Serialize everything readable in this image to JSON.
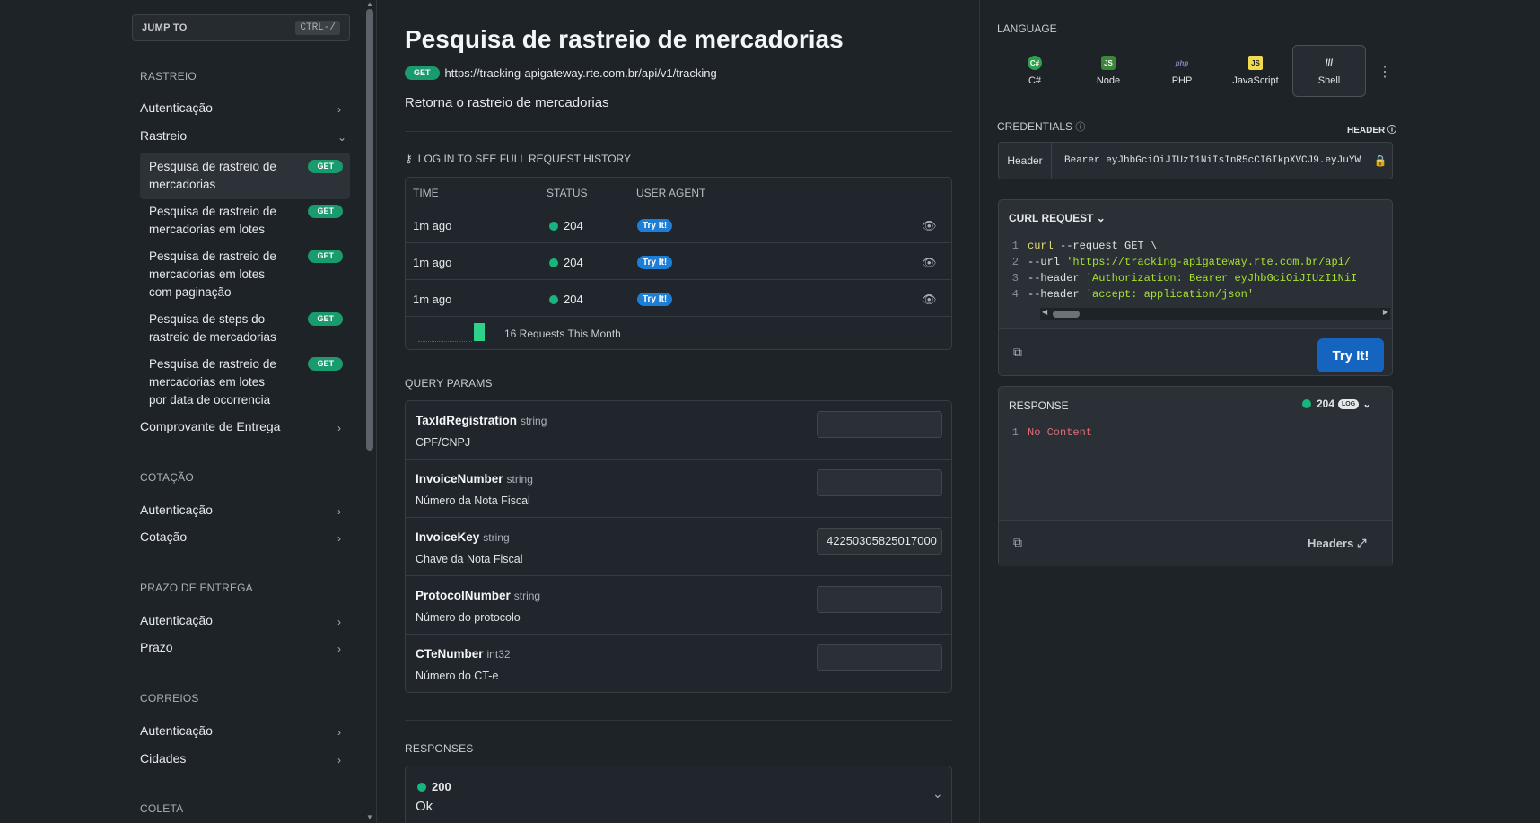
{
  "sidebar": {
    "jump_to": "JUMP TO",
    "shortcut": "CTRL-/",
    "sections": [
      {
        "title": "RASTREIO"
      },
      {
        "title": "COTAÇÃO"
      },
      {
        "title": "PRAZO DE ENTREGA"
      },
      {
        "title": "CORREIOS"
      },
      {
        "title": "COLETA"
      }
    ],
    "rastreio_items": {
      "autenticacao": "Autenticação",
      "rastreio": "Rastreio",
      "comprovante": "Comprovante de Entrega"
    },
    "rastreio_sub": [
      {
        "label": "Pesquisa de rastreio de mercadorias",
        "badge": "GET"
      },
      {
        "label": "Pesquisa de rastreio de mercadorias em lotes",
        "badge": "GET"
      },
      {
        "label": "Pesquisa de rastreio de mercadorias em lotes com paginação",
        "badge": "GET"
      },
      {
        "label": "Pesquisa de steps do rastreio de mercadorias",
        "badge": "GET"
      },
      {
        "label": "Pesquisa de rastreio de mercadorias em lotes por data de ocorrencia",
        "badge": "GET"
      }
    ],
    "cotacao_items": [
      "Autenticação",
      "Cotação"
    ],
    "prazo_items": [
      "Autenticação",
      "Prazo"
    ],
    "correios_items": [
      "Autenticação",
      "Cidades"
    ]
  },
  "main": {
    "title": "Pesquisa de rastreio de mercadorias",
    "method": "GET",
    "url": "https://tracking-apigateway.rte.com.br/api/v1/tracking",
    "description": "Retorna o rastreio de mercadorias",
    "login_hint": "LOG IN TO SEE FULL REQUEST HISTORY",
    "history": {
      "headers": [
        "TIME",
        "STATUS",
        "USER AGENT"
      ],
      "rows": [
        {
          "time": "1m ago",
          "status": "204",
          "agent": "Try It!"
        },
        {
          "time": "1m ago",
          "status": "204",
          "agent": "Try It!"
        },
        {
          "time": "1m ago",
          "status": "204",
          "agent": "Try It!"
        }
      ],
      "footer": "16 Requests This Month"
    },
    "query_params_label": "QUERY PARAMS",
    "params": [
      {
        "name": "TaxIdRegistration",
        "type": "string",
        "desc": "CPF/CNPJ",
        "value": ""
      },
      {
        "name": "InvoiceNumber",
        "type": "string",
        "desc": "Número da Nota Fiscal",
        "value": ""
      },
      {
        "name": "InvoiceKey",
        "type": "string",
        "desc": "Chave da Nota Fiscal",
        "value": "42250305825017000"
      },
      {
        "name": "ProtocolNumber",
        "type": "string",
        "desc": "Número do protocolo",
        "value": ""
      },
      {
        "name": "CTeNumber",
        "type": "int32",
        "desc": "Número do CT-e",
        "value": ""
      }
    ],
    "responses_label": "RESPONSES",
    "response": {
      "code": "200",
      "text": "Ok"
    }
  },
  "right": {
    "language_label": "LANGUAGE",
    "languages": [
      {
        "name": "C#",
        "icon": "C#",
        "color": "#2aa34a"
      },
      {
        "name": "Node",
        "icon": "JS",
        "color": "#3c873a"
      },
      {
        "name": "PHP",
        "icon": "php",
        "color": "#7a86b8"
      },
      {
        "name": "JavaScript",
        "icon": "JS",
        "color": "#f0db4f"
      },
      {
        "name": "Shell",
        "icon": "///",
        "color": "#dfe3e6"
      }
    ],
    "credentials_label": "CREDENTIALS",
    "header_label": "HEADER",
    "cred_key": "Header",
    "cred_value": "Bearer eyJhbGciOiJIUzI1NiIsInR5cCI6IkpXVCJ9.eyJuYW",
    "curl_label": "CURL REQUEST",
    "code_lines": [
      {
        "n": "1",
        "parts": [
          [
            "kw",
            "curl"
          ],
          [
            "tx",
            " --request GET \\"
          ]
        ]
      },
      {
        "n": "2",
        "parts": [
          [
            "tx",
            "     --url "
          ],
          [
            "str",
            "'https://tracking-apigateway.rte.com.br/api/"
          ]
        ]
      },
      {
        "n": "3",
        "parts": [
          [
            "tx",
            "     --header "
          ],
          [
            "str",
            "'Authorization: Bearer eyJhbGciOiJIUzI1NiI"
          ]
        ]
      },
      {
        "n": "4",
        "parts": [
          [
            "tx",
            "     --header "
          ],
          [
            "str",
            "'accept: application/json'"
          ]
        ]
      }
    ],
    "try_it": "Try It!",
    "response_label": "RESPONSE",
    "response_status": "204",
    "log_badge": "LOG",
    "response_line_no": "1",
    "response_body": "No Content",
    "headers_link": "Headers"
  }
}
